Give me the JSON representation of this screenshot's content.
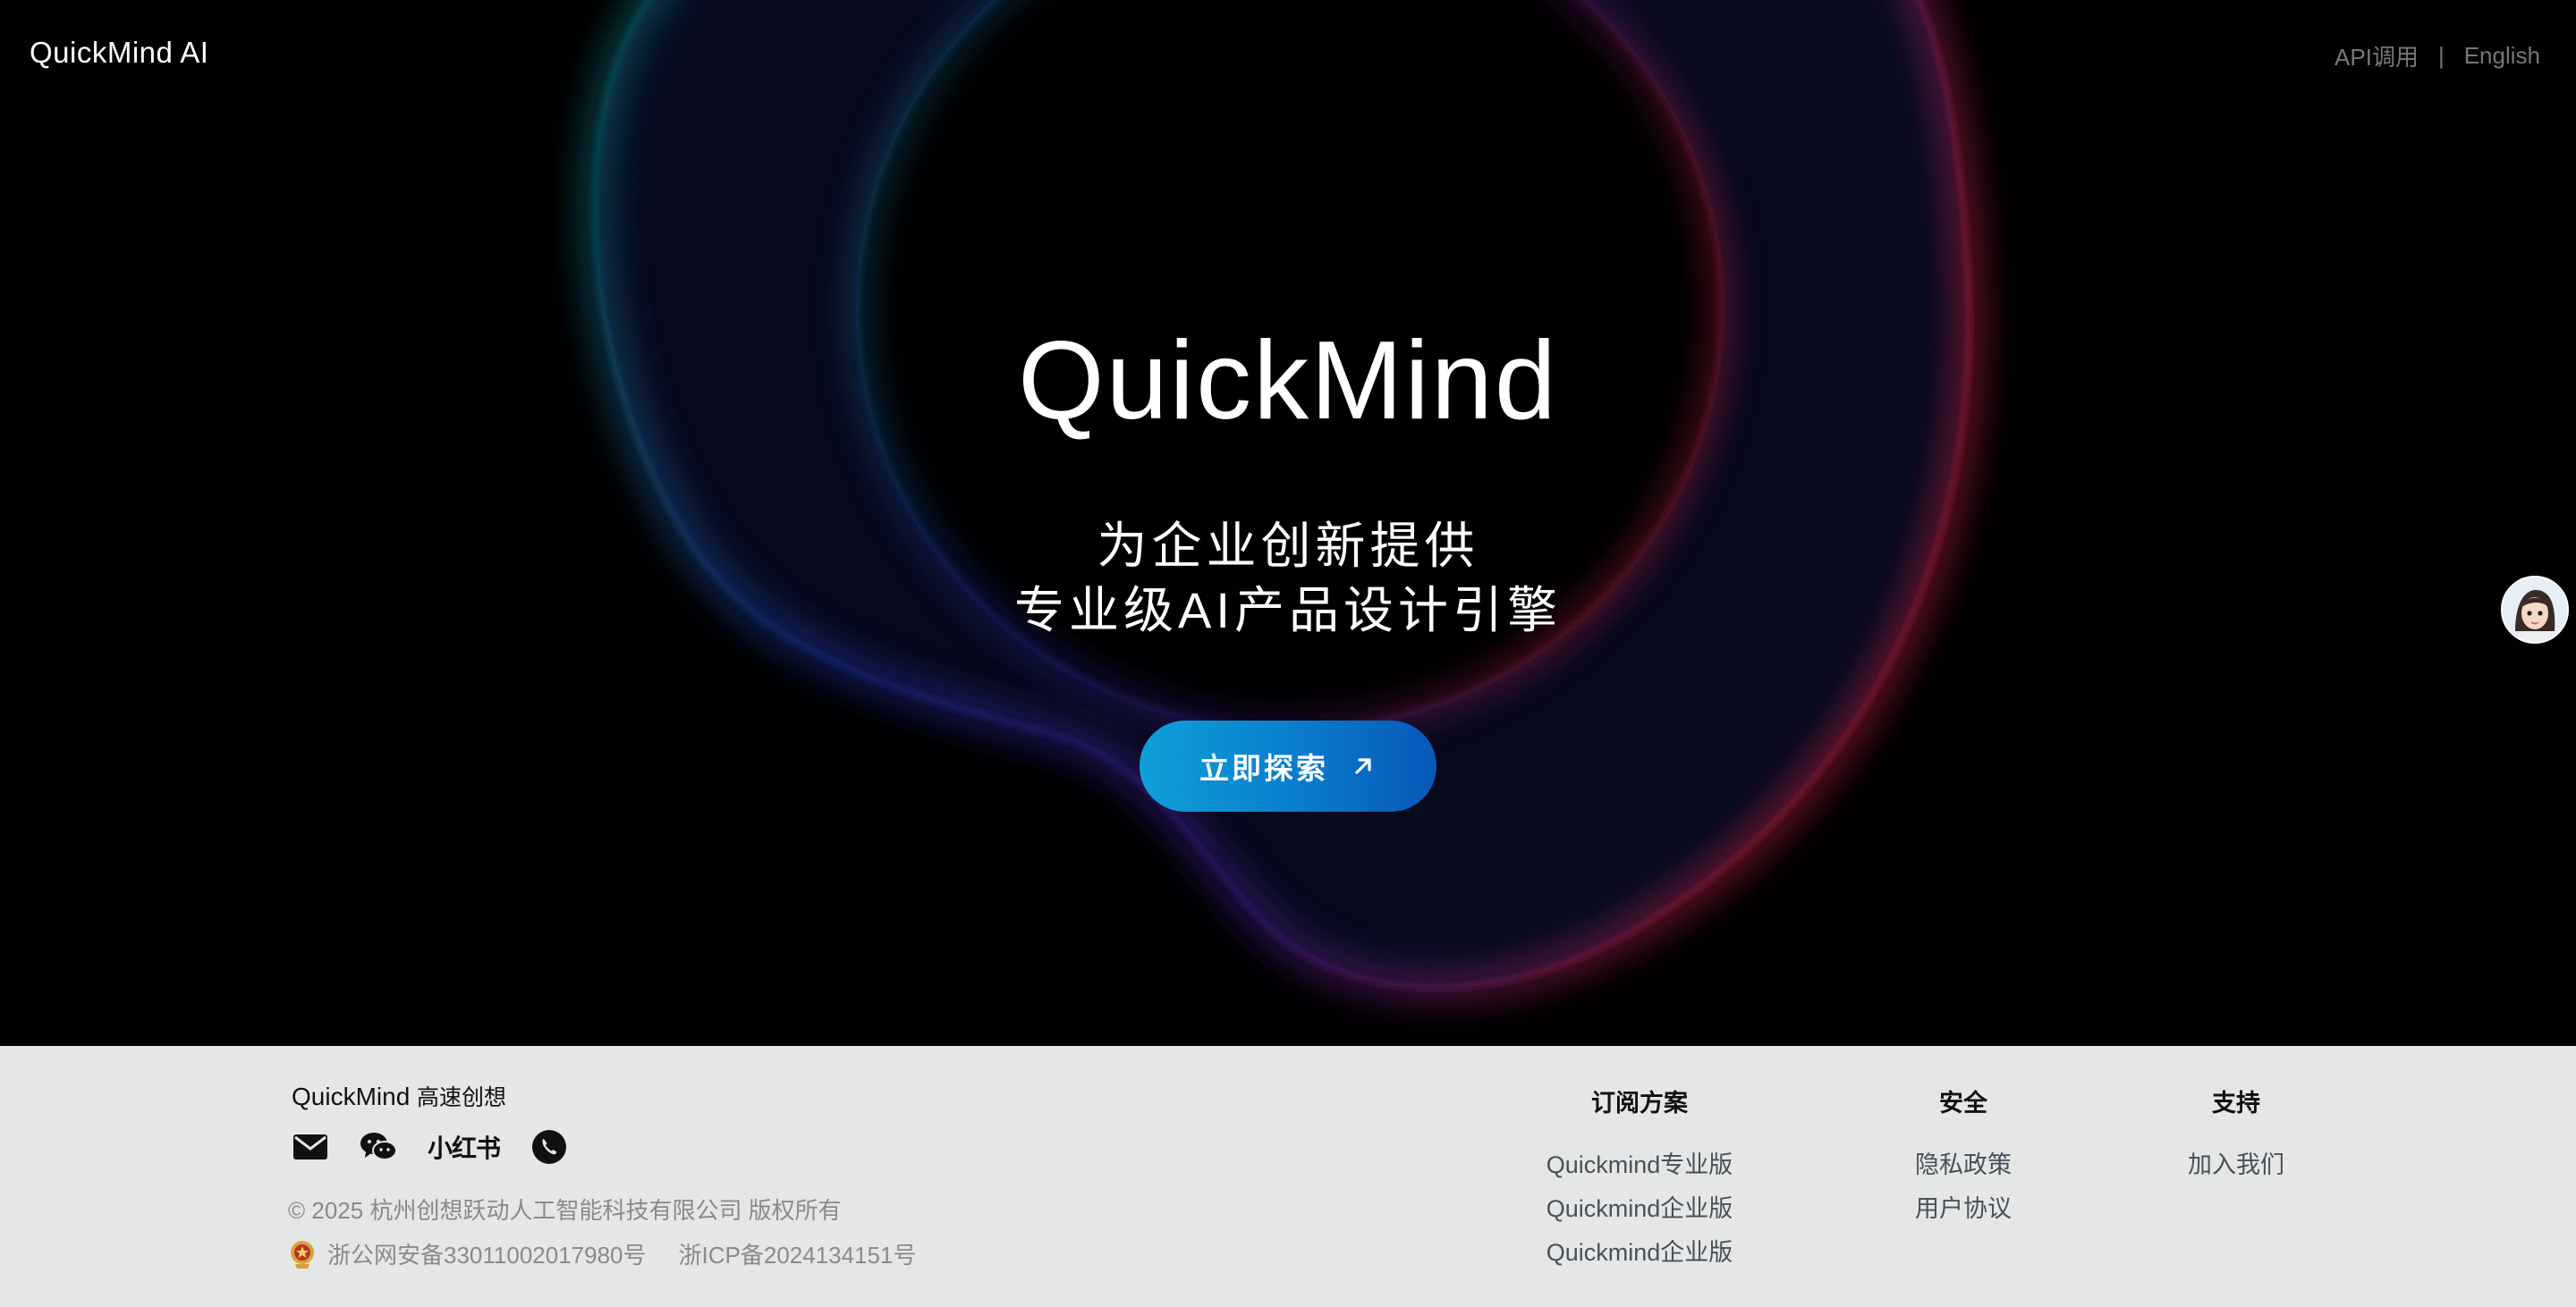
{
  "header": {
    "brand": "QuickMind AI",
    "nav": {
      "api_label": "API调用",
      "separator": "|",
      "lang_label": "English"
    }
  },
  "hero": {
    "title": "QuickMind",
    "subtitle_line1": "为企业创新提供",
    "subtitle_line2": "专业级AI产品设计引擎",
    "cta_label": "立即探索",
    "cta_icon": "arrow-up-right-icon"
  },
  "assistant": {
    "icon": "avatar-assistant-icon"
  },
  "footer": {
    "brand": "QuickMind",
    "brand_tagline": "高速创想",
    "socials": [
      {
        "icon": "mail-icon"
      },
      {
        "icon": "wechat-icon"
      },
      {
        "label": "小红书"
      },
      {
        "icon": "phone-icon"
      }
    ],
    "copyright": "© 2025 杭州创想跃动人工智能科技有限公司 版权所有",
    "police_record": "浙公网安备33011002017980号",
    "icp_record": "浙ICP备2024134151号",
    "columns": [
      {
        "title": "订阅方案",
        "links": [
          "Quickmind专业版",
          "Quickmind企业版",
          "Quickmind企业版"
        ]
      },
      {
        "title": "安全",
        "links": [
          "隐私政策",
          "用户协议"
        ]
      },
      {
        "title": "支持",
        "links": [
          "加入我们"
        ]
      }
    ]
  },
  "colors": {
    "hero_bg": "#000000",
    "footer_bg": "#e5e7e6",
    "cta_start": "#0fa0d8",
    "cta_end": "#0758b8",
    "footer_muted": "#8a8a8a"
  }
}
